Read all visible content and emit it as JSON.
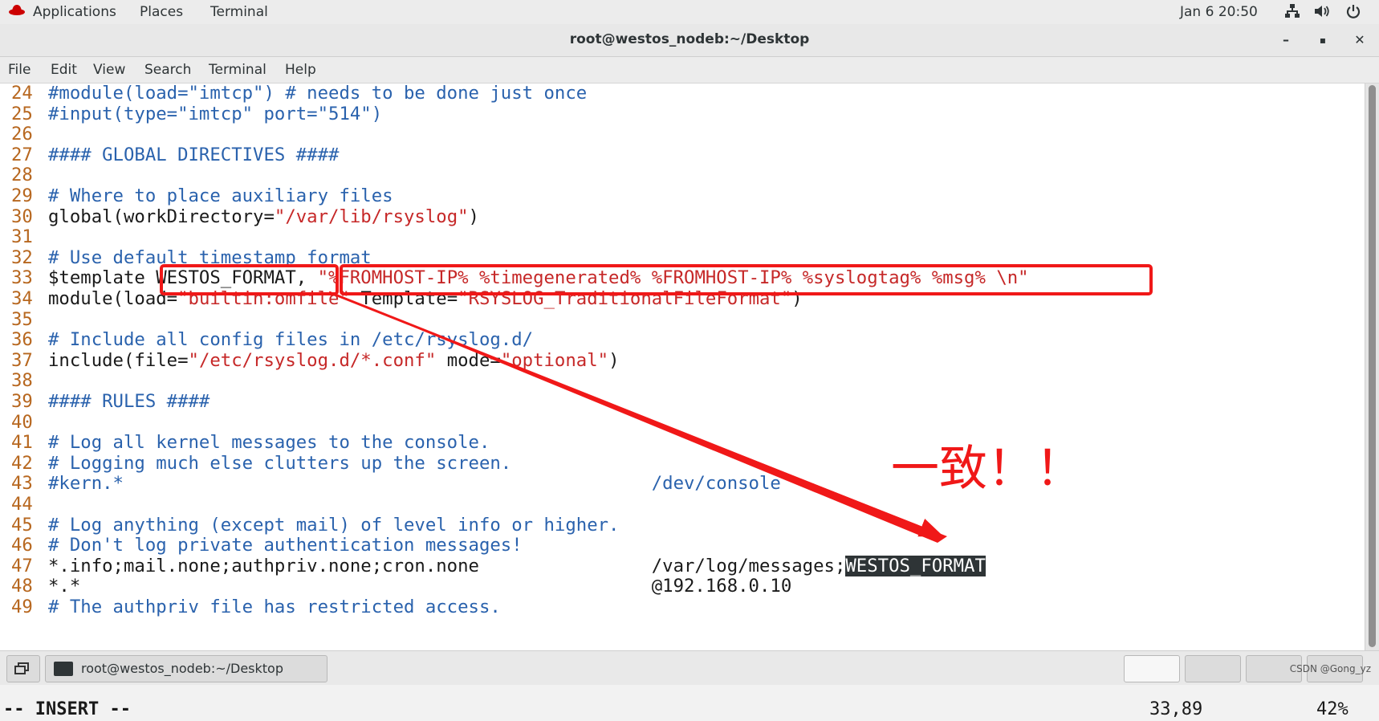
{
  "topbar": {
    "applications": "Applications",
    "places": "Places",
    "terminal": "Terminal",
    "clock": "Jan 6  20:50",
    "icons": [
      "redhat-icon",
      "network-icon",
      "volume-icon",
      "power-icon"
    ]
  },
  "window": {
    "title": "root@westos_nodeb:~/Desktop",
    "minimize": "–",
    "maximize": "▪",
    "close": "✕"
  },
  "menu": [
    "File",
    "Edit",
    "View",
    "Search",
    "Terminal",
    "Help"
  ],
  "editor": {
    "lines": [
      {
        "n": "24",
        "segs": [
          {
            "t": "#module(load=\"imtcp\") # needs to be done just once",
            "c": "cm"
          }
        ]
      },
      {
        "n": "25",
        "segs": [
          {
            "t": "#input(type=\"imtcp\" port=\"514\")",
            "c": "cm"
          }
        ]
      },
      {
        "n": "26",
        "segs": []
      },
      {
        "n": "27",
        "segs": [
          {
            "t": "#### GLOBAL DIRECTIVES ####",
            "c": "cm"
          }
        ]
      },
      {
        "n": "28",
        "segs": []
      },
      {
        "n": "29",
        "segs": [
          {
            "t": "# Where to place auxiliary files",
            "c": "cm"
          }
        ]
      },
      {
        "n": "30",
        "segs": [
          {
            "t": "global(workDirectory=",
            "c": "pl"
          },
          {
            "t": "\"/var/lib/rsyslog\"",
            "c": "str"
          },
          {
            "t": ")",
            "c": "pl"
          }
        ]
      },
      {
        "n": "31",
        "segs": []
      },
      {
        "n": "32",
        "segs": [
          {
            "t": "# Use default timestamp format",
            "c": "cm"
          }
        ]
      },
      {
        "n": "33",
        "segs": [
          {
            "t": "$template WESTOS_FORMAT, ",
            "c": "pl"
          },
          {
            "t": "\"%FROMHOST-IP% %timegenerated% %FROMHOST-IP% %syslogtag% %msg% \\n\"",
            "c": "str"
          }
        ]
      },
      {
        "n": "34",
        "segs": [
          {
            "t": "module(load=",
            "c": "pl"
          },
          {
            "t": "\"builtin:omfile\"",
            "c": "str"
          },
          {
            "t": " Template=",
            "c": "pl"
          },
          {
            "t": "\"RSYSLOG_TraditionalFileFormat\"",
            "c": "str"
          },
          {
            "t": ")",
            "c": "pl"
          }
        ]
      },
      {
        "n": "35",
        "segs": []
      },
      {
        "n": "36",
        "segs": [
          {
            "t": "# Include all config files in /etc/rsyslog.d/",
            "c": "cm"
          }
        ]
      },
      {
        "n": "37",
        "segs": [
          {
            "t": "include(file=",
            "c": "pl"
          },
          {
            "t": "\"/etc/rsyslog.d/*.conf\"",
            "c": "str"
          },
          {
            "t": " mode=",
            "c": "pl"
          },
          {
            "t": "\"optional\"",
            "c": "str"
          },
          {
            "t": ")",
            "c": "pl"
          }
        ]
      },
      {
        "n": "38",
        "segs": []
      },
      {
        "n": "39",
        "segs": [
          {
            "t": "#### RULES ####",
            "c": "cm"
          }
        ]
      },
      {
        "n": "40",
        "segs": []
      },
      {
        "n": "41",
        "segs": [
          {
            "t": "# Log all kernel messages to the console.",
            "c": "cm"
          }
        ]
      },
      {
        "n": "42",
        "segs": [
          {
            "t": "# Logging much else clutters up the screen.",
            "c": "cm"
          }
        ]
      },
      {
        "n": "43",
        "segs": [
          {
            "t": "#kern.*                                                 /dev/console",
            "c": "cm"
          }
        ]
      },
      {
        "n": "44",
        "segs": []
      },
      {
        "n": "45",
        "segs": [
          {
            "t": "# Log anything (except mail) of level info or higher.",
            "c": "cm"
          }
        ]
      },
      {
        "n": "46",
        "segs": [
          {
            "t": "# Don't log private authentication messages!",
            "c": "cm"
          }
        ]
      },
      {
        "n": "47",
        "segs": [
          {
            "t": "*.info;mail.none;authpriv.none;cron.none                /var/log/messages;",
            "c": "pl"
          },
          {
            "t": "WESTOS_FORMAT",
            "c": "hl"
          }
        ]
      },
      {
        "n": "48",
        "segs": [
          {
            "t": "*.*                                                     @192.168.0.10",
            "c": "pl"
          }
        ]
      },
      {
        "n": "49",
        "segs": [
          {
            "t": "# The authpriv file has restricted access.",
            "c": "cm"
          }
        ]
      }
    ],
    "mode": "-- INSERT --",
    "position": "33,89",
    "percent": "42%"
  },
  "annotation": {
    "note": "一致！！"
  },
  "taskbar": {
    "task_label": "root@westos_nodeb:~/Desktop"
  },
  "watermark": "CSDN @Gong_yz",
  "colors": {
    "comment": "#2a62ad",
    "string": "#c62828",
    "line_number": "#b7671f",
    "annotation": "#f01818"
  }
}
